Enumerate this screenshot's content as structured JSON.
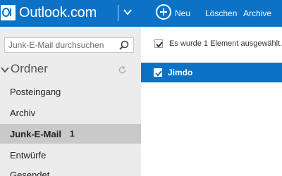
{
  "header": {
    "brand": "Outlook.com",
    "new_label": "Neu",
    "delete_label": "Löschen",
    "archive_label": "Archive"
  },
  "sidebar": {
    "search_placeholder": "Junk-E-Mail durchsuchen",
    "folders_title": "Ordner",
    "folders": [
      {
        "label": "Posteingang"
      },
      {
        "label": "Archiv"
      },
      {
        "label": "Junk-E-Mail",
        "count": "1",
        "active": true
      },
      {
        "label": "Entwürfe"
      },
      {
        "label": "Gesendet"
      }
    ]
  },
  "main": {
    "selection_text": "Es wurde 1 Element ausgewählt.",
    "messages": [
      {
        "sender": "Jimdo",
        "selected": true
      }
    ]
  },
  "colors": {
    "accent": "#0b72c5",
    "sidebar_bg": "#ececec",
    "active_folder_bg": "#c9c9c9"
  }
}
